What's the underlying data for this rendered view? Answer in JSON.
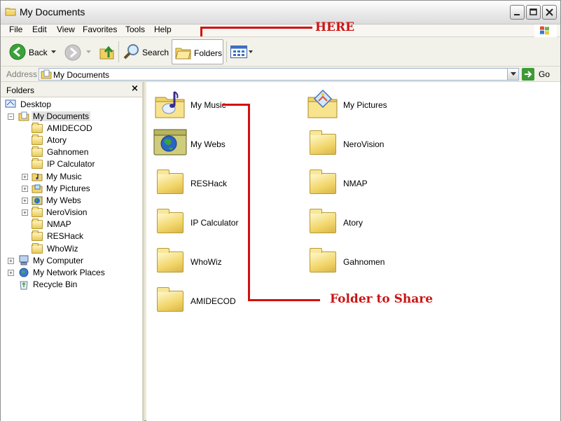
{
  "window": {
    "title": "My Documents"
  },
  "menu": {
    "file": "File",
    "edit": "Edit",
    "view": "View",
    "favorites": "Favorites",
    "tools": "Tools",
    "help": "Help"
  },
  "toolbar": {
    "back": "Back",
    "search": "Search",
    "folders": "Folders"
  },
  "address": {
    "label": "Address",
    "value": "My Documents",
    "go": "Go"
  },
  "folders_pane": {
    "title": "Folders",
    "close": "×",
    "tree": [
      {
        "label": "Desktop"
      },
      {
        "label": "My Documents"
      },
      {
        "label": "AMIDECOD"
      },
      {
        "label": "Atory"
      },
      {
        "label": "Gahnomen"
      },
      {
        "label": "IP Calculator"
      },
      {
        "label": "My Music"
      },
      {
        "label": "My Pictures"
      },
      {
        "label": "My Webs"
      },
      {
        "label": "NeroVision"
      },
      {
        "label": "NMAP"
      },
      {
        "label": "RESHack"
      },
      {
        "label": "WhoWiz"
      },
      {
        "label": "My Computer"
      },
      {
        "label": "My Network Places"
      },
      {
        "label": "Recycle Bin"
      }
    ]
  },
  "content": {
    "items": [
      {
        "label": "My Music",
        "icon": "music-folder-icon"
      },
      {
        "label": "My Pictures",
        "icon": "pictures-folder-icon"
      },
      {
        "label": "My Webs",
        "icon": "webs-folder-icon"
      },
      {
        "label": "NeroVision",
        "icon": "folder-icon"
      },
      {
        "label": "RESHack",
        "icon": "folder-icon"
      },
      {
        "label": "NMAP",
        "icon": "folder-icon"
      },
      {
        "label": "IP Calculator",
        "icon": "folder-icon"
      },
      {
        "label": "Atory",
        "icon": "folder-icon"
      },
      {
        "label": "WhoWiz",
        "icon": "folder-icon"
      },
      {
        "label": "Gahnomen",
        "icon": "folder-icon"
      },
      {
        "label": "AMIDECOD",
        "icon": "folder-icon"
      }
    ]
  },
  "annotations": {
    "here": "HERE",
    "share": "Folder to Share",
    "color": "#cc1414"
  }
}
